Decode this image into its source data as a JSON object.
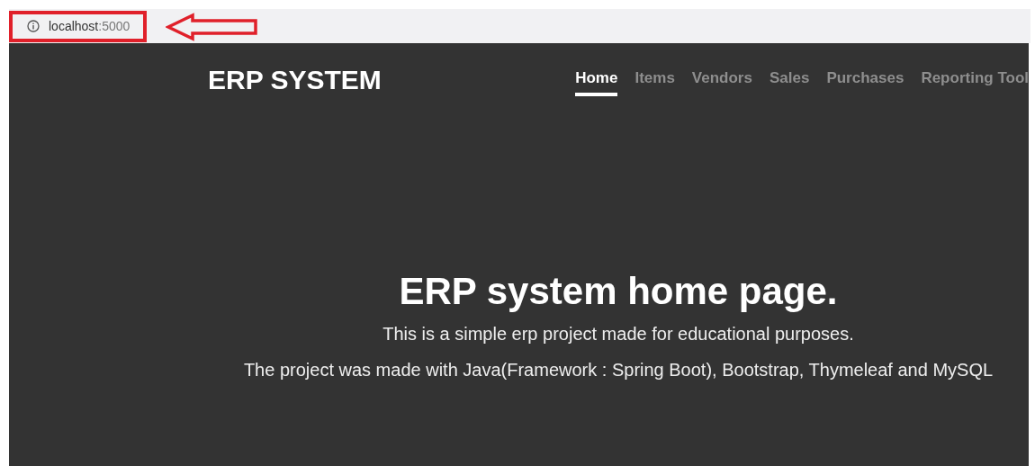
{
  "address_bar": {
    "host": "localhost",
    "port": ":5000"
  },
  "navbar": {
    "brand": "ERP SYSTEM",
    "items": [
      {
        "label": "Home",
        "selected": true
      },
      {
        "label": "Items",
        "selected": false
      },
      {
        "label": "Vendors",
        "selected": false
      },
      {
        "label": "Sales",
        "selected": false
      },
      {
        "label": "Purchases",
        "selected": false
      },
      {
        "label": "Reporting Tool",
        "selected": false
      }
    ]
  },
  "hero": {
    "heading": "ERP system home page.",
    "paragraphs": [
      "This is a simple erp project made for educational purposes.",
      "The project was made with Java(Framework : Spring Boot), Bootstrap, Thymeleaf and MySQL"
    ]
  }
}
